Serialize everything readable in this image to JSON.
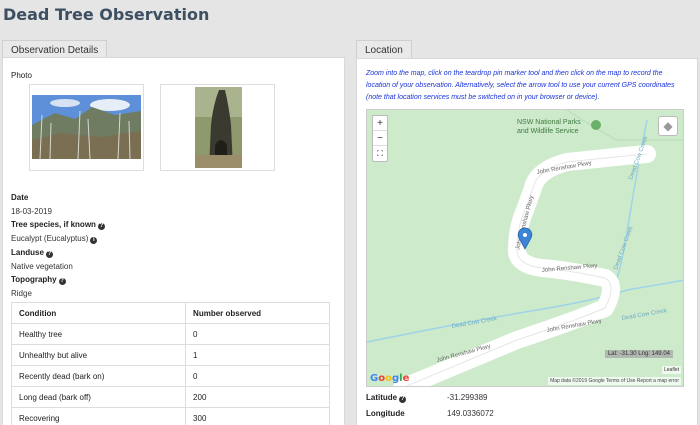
{
  "page_title": "Dead Tree Observation",
  "observation": {
    "tab_label": "Observation Details",
    "photo_label": "Photo",
    "date_label": "Date",
    "date_value": "18-03-2019",
    "species_label": "Tree species, if known",
    "species_value": "Eucalypt (Eucalyptus)",
    "landuse_label": "Landuse",
    "landuse_value": "Native vegetation",
    "topography_label": "Topography",
    "topography_value": "Ridge",
    "table": {
      "headers": [
        "Condition",
        "Number observed"
      ],
      "rows": [
        [
          "Healthy tree",
          "0"
        ],
        [
          "Unhealthy but alive",
          "1"
        ],
        [
          "Recently dead (bark on)",
          "0"
        ],
        [
          "Long dead (bark off)",
          "200"
        ],
        [
          "Recovering",
          "300"
        ]
      ]
    }
  },
  "location": {
    "tab_label": "Location",
    "instructions": "Zoom into the map, click on the teardrop pin marker tool and then click on the map to record the location of your observation. Alternatively, select the arrow tool to use your current GPS coordinates (note that location services must be switched on in your browser or device).",
    "map": {
      "zoom_in": "+",
      "zoom_out": "−",
      "latlng_readout": "Lat: -31.30 Lng: 149.04",
      "leaflet_attribution": "Leaflet",
      "map_attribution": "Map data ©2019 Google   Terms of Use   Report a map error",
      "google_logo": "Google",
      "park_label_line1": "NSW National Parks",
      "park_label_line2": "and Wildlife Service",
      "road_labels": [
        "John Renshaw Pkwy",
        "John Renshaw Pkwy",
        "John Renshaw Pkwy",
        "John Renshaw Pkwy",
        "John Renshaw Pkwy"
      ],
      "creek_labels": [
        "Dead Cow Creek",
        "Dead Cow Creek",
        "Dead Cow Creek",
        "Dead Cow Creek"
      ]
    },
    "latitude_label": "Latitude",
    "latitude_value": "-31.299389",
    "longitude_label": "Longitude",
    "longitude_value": "149.0336072"
  },
  "colors": {
    "title": "#3d4f60",
    "instructions": "#1a33d9",
    "map_background": "#cdebcb",
    "road": "#ffffff",
    "marker": "#3b84d6"
  }
}
